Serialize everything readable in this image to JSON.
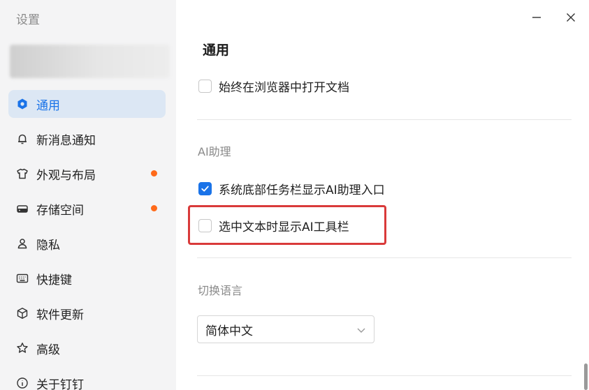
{
  "app": {
    "title": "设置"
  },
  "sidebar": {
    "items": [
      {
        "label": "通用",
        "icon": "hexagon-icon",
        "active": true,
        "badge": false
      },
      {
        "label": "新消息通知",
        "icon": "bell-icon",
        "active": false,
        "badge": false
      },
      {
        "label": "外观与布局",
        "icon": "shirt-icon",
        "active": false,
        "badge": true
      },
      {
        "label": "存储空间",
        "icon": "storage-icon",
        "active": false,
        "badge": true
      },
      {
        "label": "隐私",
        "icon": "user-icon",
        "active": false,
        "badge": false
      },
      {
        "label": "快捷键",
        "icon": "keyboard-icon",
        "active": false,
        "badge": false
      },
      {
        "label": "软件更新",
        "icon": "box-icon",
        "active": false,
        "badge": false
      },
      {
        "label": "高级",
        "icon": "star-icon",
        "active": false,
        "badge": false
      },
      {
        "label": "关于钉钉",
        "icon": "info-icon",
        "active": false,
        "badge": false
      }
    ]
  },
  "main": {
    "section_title": "通用",
    "open_in_browser": {
      "label": "始终在浏览器中打开文档",
      "checked": false
    },
    "ai_group_label": "AI助理",
    "ai_taskbar": {
      "label": "系统底部任务栏显示AI助理入口",
      "checked": true
    },
    "ai_toolbar": {
      "label": "选中文本时显示AI工具栏",
      "checked": false
    },
    "language_group_label": "切换语言",
    "language_select": {
      "value": "简体中文"
    }
  },
  "colors": {
    "accent": "#1a73e8",
    "badge": "#ff6a1a",
    "highlight": "#d93a3a",
    "sidebar_bg": "#f4f4f5"
  }
}
